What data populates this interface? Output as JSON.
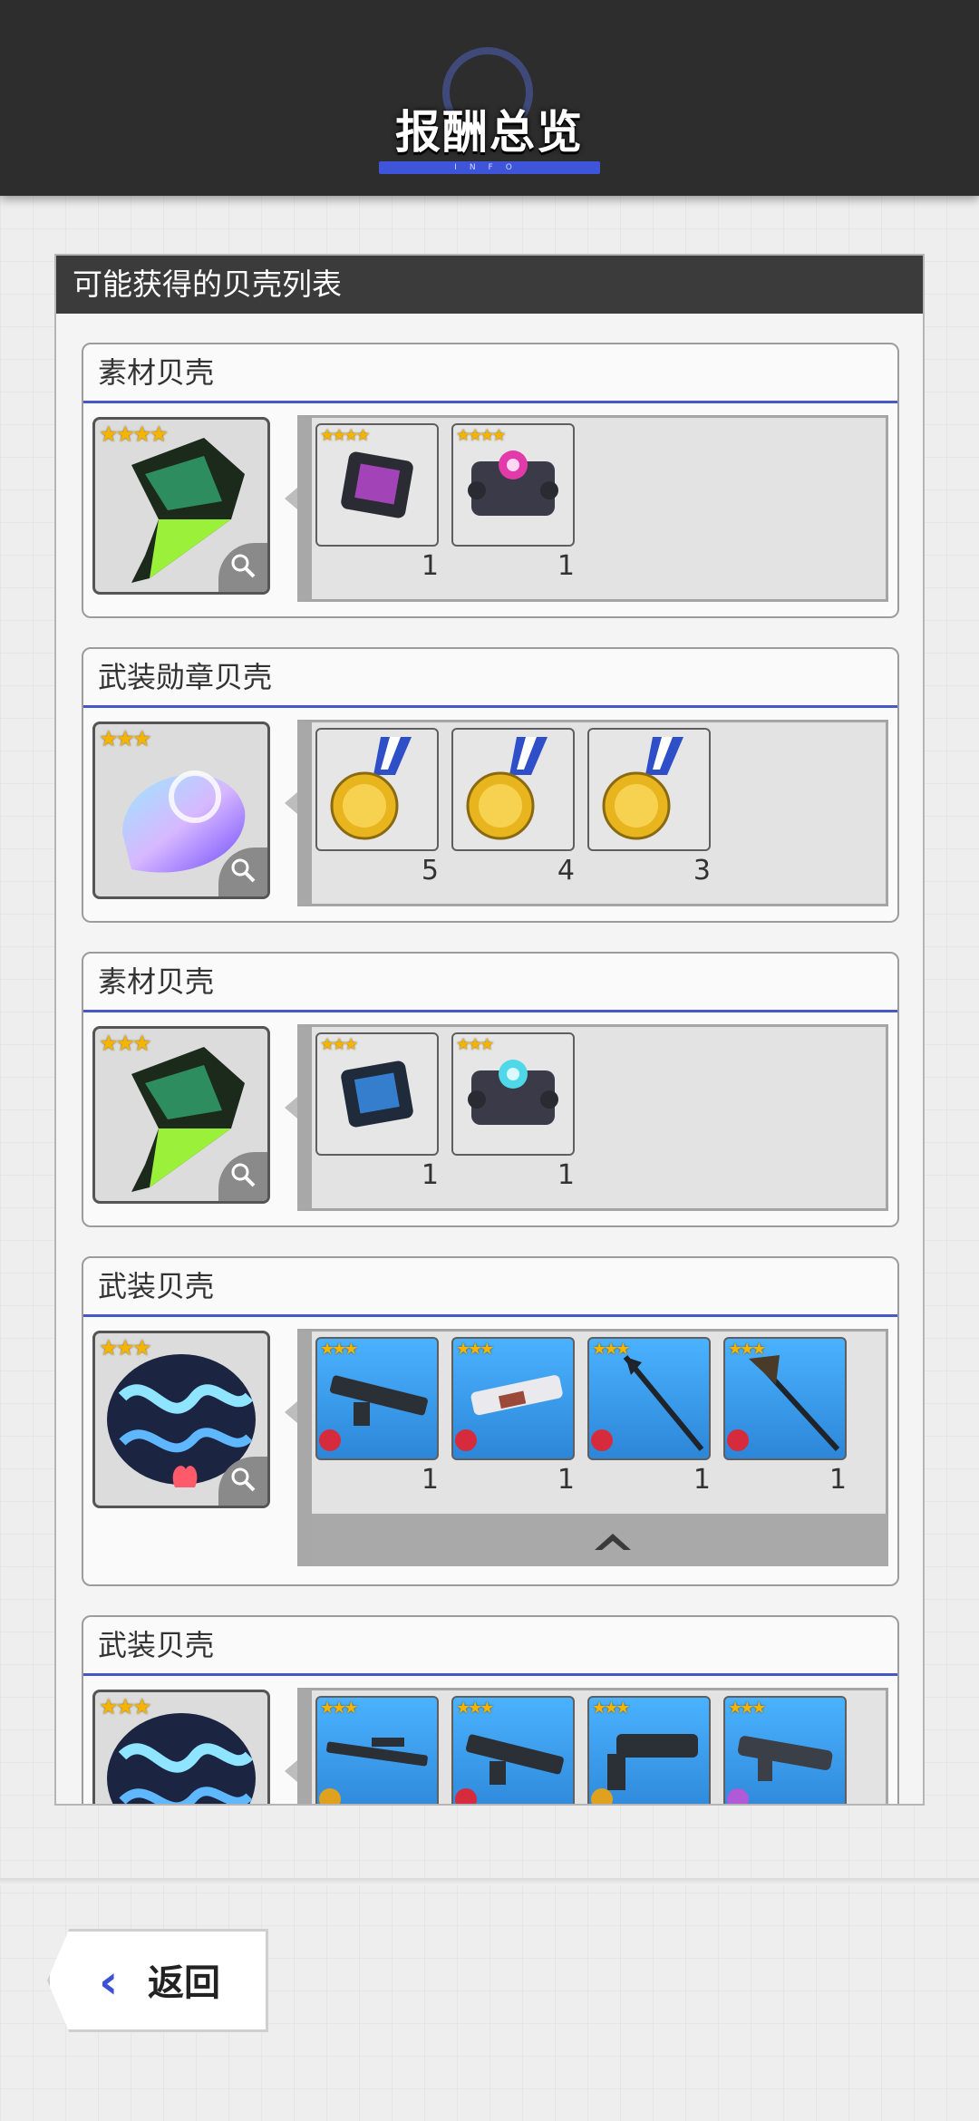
{
  "header": {
    "title": "报酬总览",
    "subtitle": "INFO"
  },
  "panel": {
    "title": "可能获得的贝壳列表",
    "cards": [
      {
        "title": "素材贝壳",
        "shell_stars": "★★★★",
        "shell_icon": "green-conch-shell-icon",
        "items": [
          {
            "stars": "★★★★",
            "icon": "chip-icon",
            "qty": "1"
          },
          {
            "stars": "★★★★",
            "icon": "core-device-icon",
            "qty": "1"
          }
        ]
      },
      {
        "title": "武装勋章贝壳",
        "shell_stars": "★★★",
        "shell_icon": "rainbow-nautilus-shell-icon",
        "items": [
          {
            "stars": "",
            "icon": "gold-medal-icon",
            "qty": "5"
          },
          {
            "stars": "",
            "icon": "gold-medal-icon",
            "qty": "4"
          },
          {
            "stars": "",
            "icon": "gold-medal-icon",
            "qty": "3"
          }
        ]
      },
      {
        "title": "素材贝壳",
        "shell_stars": "★★★",
        "shell_icon": "green-conch-shell-icon",
        "items": [
          {
            "stars": "★★★",
            "icon": "chip-icon",
            "qty": "1"
          },
          {
            "stars": "★★★",
            "icon": "core-device-icon",
            "qty": "1"
          }
        ]
      },
      {
        "title": "武装贝壳",
        "shell_stars": "★★★",
        "shell_icon": "blue-clam-shell-icon",
        "items": [
          {
            "stars": "★★★",
            "icon": "assault-rifle-icon",
            "qty": "1"
          },
          {
            "stars": "★★★",
            "icon": "cannon-gun-icon",
            "qty": "1"
          },
          {
            "stars": "★★★",
            "icon": "spear-icon",
            "qty": "1"
          },
          {
            "stars": "★★★",
            "icon": "halberd-icon",
            "qty": "1"
          }
        ]
      },
      {
        "title": "武装贝壳",
        "shell_stars": "★★★",
        "shell_icon": "blue-clam-shell-icon",
        "items": [
          {
            "stars": "★★★",
            "icon": "sniper-rifle-icon",
            "qty": ""
          },
          {
            "stars": "★★★",
            "icon": "assault-rifle-icon",
            "qty": ""
          },
          {
            "stars": "★★★",
            "icon": "heavy-gun-icon",
            "qty": ""
          },
          {
            "stars": "★★★",
            "icon": "blaster-icon",
            "qty": ""
          }
        ]
      }
    ]
  },
  "back_button": {
    "label": "返回"
  },
  "colors": {
    "accent": "#3f55d9",
    "panel_header": "#3b3b3b",
    "weapon_bg": "#4ab2ff"
  }
}
